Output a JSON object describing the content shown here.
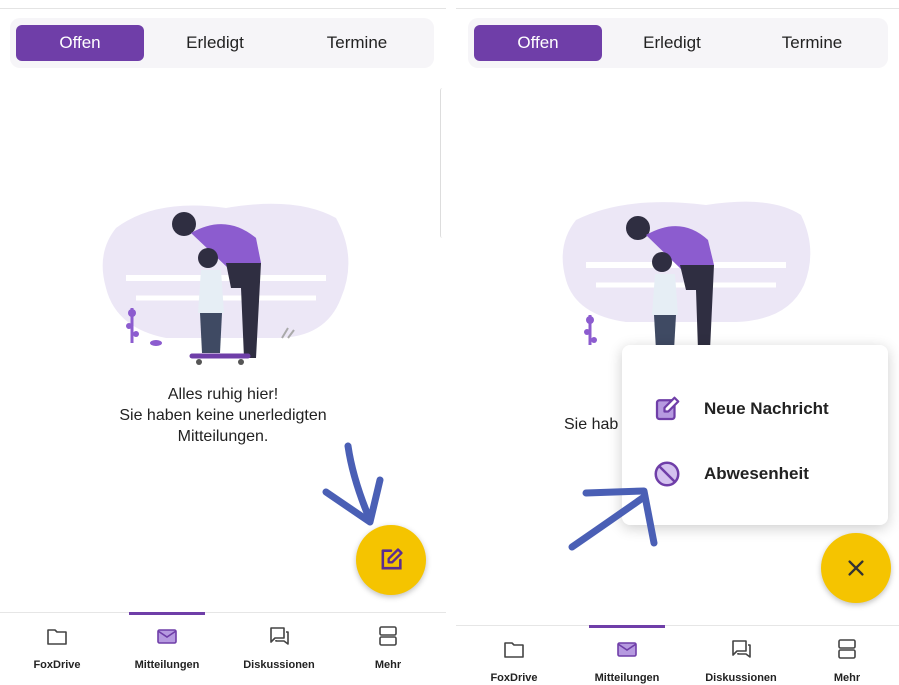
{
  "colors": {
    "accent": "#6f3ea8",
    "fab": "#f5c400",
    "annotation": "#4a5fb5",
    "illustration": "#e9e3f5"
  },
  "left": {
    "tabs": [
      {
        "label": "Offen",
        "active": true
      },
      {
        "label": "Erledigt",
        "active": false
      },
      {
        "label": "Termine",
        "active": false
      }
    ],
    "empty_state": {
      "line1": "Alles ruhig hier!",
      "line2": "Sie haben keine unerledigten",
      "line3": "Mitteilungen."
    },
    "fab_icon": "compose-icon",
    "nav": [
      {
        "label": "FoxDrive",
        "icon": "folder-icon",
        "active": false
      },
      {
        "label": "Mitteilungen",
        "icon": "mail-icon",
        "active": true
      },
      {
        "label": "Diskussionen",
        "icon": "chat-icon",
        "active": false
      },
      {
        "label": "Mehr",
        "icon": "more-icon",
        "active": false
      }
    ]
  },
  "right": {
    "tabs": [
      {
        "label": "Offen",
        "active": true
      },
      {
        "label": "Erledigt",
        "active": false
      },
      {
        "label": "Termine",
        "active": false
      }
    ],
    "partial_text": "Sie hab",
    "menu": [
      {
        "label": "Neue Nachricht",
        "icon": "compose-icon"
      },
      {
        "label": "Abwesenheit",
        "icon": "block-icon"
      }
    ],
    "fab_icon": "close-icon",
    "nav": [
      {
        "label": "FoxDrive",
        "icon": "folder-icon",
        "active": false
      },
      {
        "label": "Mitteilungen",
        "icon": "mail-icon",
        "active": true
      },
      {
        "label": "Diskussionen",
        "icon": "chat-icon",
        "active": false
      },
      {
        "label": "Mehr",
        "icon": "more-icon",
        "active": false
      }
    ]
  }
}
